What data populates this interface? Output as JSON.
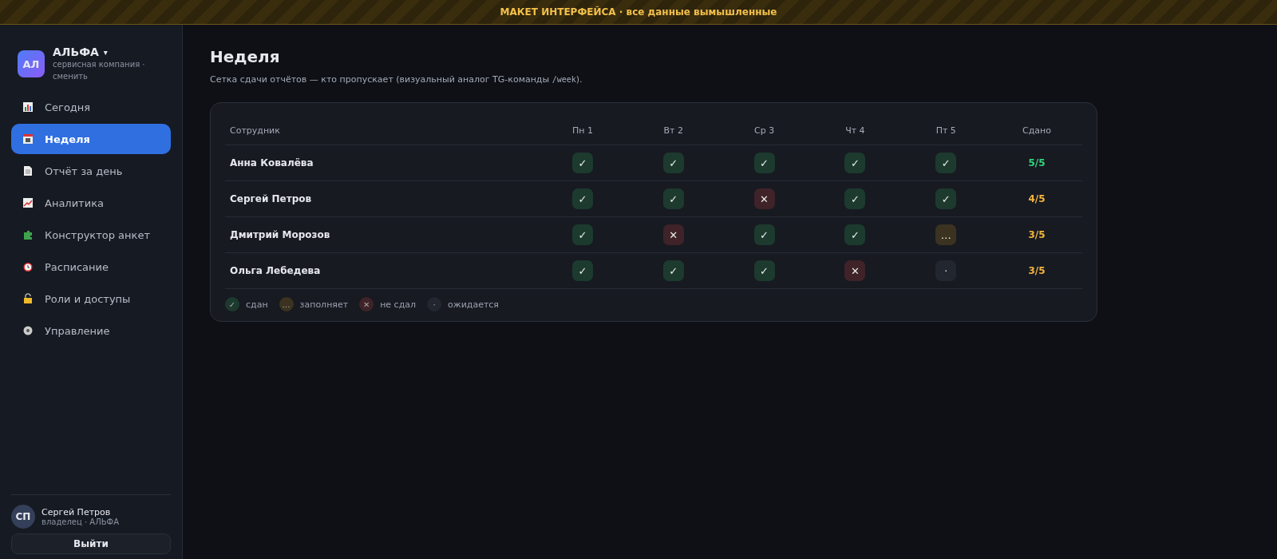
{
  "banner": {
    "title": "МАКЕТ ИНТЕРФЕЙСА",
    "note": "· все данные вымышленные"
  },
  "org": {
    "initials": "АЛ",
    "name": "АЛЬФА",
    "caret": "▾",
    "subtitle": "сервисная компания ·",
    "switch": "сменить"
  },
  "nav": [
    {
      "label": "Сегодня",
      "selected": false
    },
    {
      "label": "Неделя",
      "selected": true
    },
    {
      "label": "Отчёт за день",
      "selected": false
    },
    {
      "label": "Аналитика",
      "selected": false
    },
    {
      "label": "Конструктор анкет",
      "selected": false
    },
    {
      "label": "Расписание",
      "selected": false
    },
    {
      "label": "Роли и доступы",
      "selected": false
    },
    {
      "label": "Управление",
      "selected": false
    }
  ],
  "user": {
    "initials": "СП",
    "name": "Сергей Петров",
    "role": "владелец · АЛЬФА",
    "logout": "Выйти"
  },
  "page": {
    "title": "Неделя",
    "subtitle": "Сетка сдачи отчётов — кто пропускает (визуальный аналог TG-команды",
    "command": "/week",
    "tail": ")."
  },
  "table": {
    "columns": [
      "Сотрудник",
      "Пн 1",
      "Вт 2",
      "Ср 3",
      "Чт 4",
      "Пт 5",
      "Сдано"
    ],
    "rows": [
      {
        "cells": [
          {
            "kind": "name",
            "text": "Анна Ковалёва"
          },
          {
            "kind": "done",
            "text": "✓"
          },
          {
            "kind": "done",
            "text": "✓"
          },
          {
            "kind": "done",
            "text": "✓"
          },
          {
            "kind": "done",
            "text": "✓"
          },
          {
            "kind": "done",
            "text": "✓"
          },
          {
            "kind": "total",
            "text": "5/5",
            "complete": true
          }
        ]
      },
      {
        "cells": [
          {
            "kind": "name",
            "text": "Сергей Петров"
          },
          {
            "kind": "done",
            "text": "✓"
          },
          {
            "kind": "done",
            "text": "✓"
          },
          {
            "kind": "missed",
            "text": "✕"
          },
          {
            "kind": "done",
            "text": "✓"
          },
          {
            "kind": "done",
            "text": "✓"
          },
          {
            "kind": "total",
            "text": "4/5",
            "complete": false
          }
        ]
      },
      {
        "cells": [
          {
            "kind": "name",
            "text": "Дмитрий Морозов"
          },
          {
            "kind": "done",
            "text": "✓"
          },
          {
            "kind": "missed",
            "text": "✕"
          },
          {
            "kind": "done",
            "text": "✓"
          },
          {
            "kind": "done",
            "text": "✓"
          },
          {
            "kind": "filling",
            "text": "…"
          },
          {
            "kind": "total",
            "text": "3/5",
            "complete": false
          }
        ]
      },
      {
        "cells": [
          {
            "kind": "name",
            "text": "Ольга Лебедева"
          },
          {
            "kind": "done",
            "text": "✓"
          },
          {
            "kind": "done",
            "text": "✓"
          },
          {
            "kind": "done",
            "text": "✓"
          },
          {
            "kind": "missed",
            "text": "✕"
          },
          {
            "kind": "pending",
            "text": "·"
          },
          {
            "kind": "total",
            "text": "3/5",
            "complete": false
          }
        ]
      }
    ]
  },
  "legend": [
    {
      "kind": "done",
      "mark": "✓",
      "label": "сдан"
    },
    {
      "kind": "filling",
      "mark": "…",
      "label": "заполняет"
    },
    {
      "kind": "missed",
      "mark": "✕",
      "label": "не сдал"
    },
    {
      "kind": "pending",
      "mark": "·",
      "label": "ожидается"
    }
  ]
}
